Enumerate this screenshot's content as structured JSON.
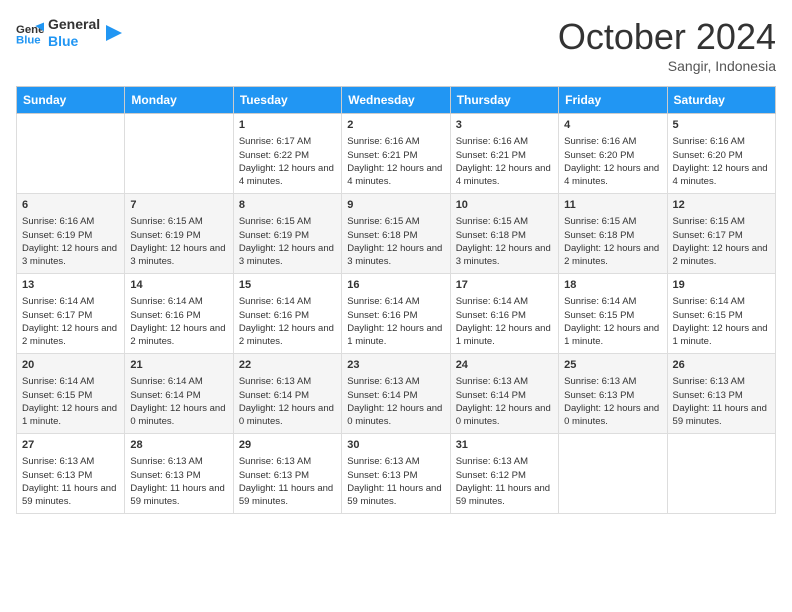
{
  "logo": {
    "text_general": "General",
    "text_blue": "Blue"
  },
  "header": {
    "month": "October 2024",
    "location": "Sangir, Indonesia"
  },
  "weekdays": [
    "Sunday",
    "Monday",
    "Tuesday",
    "Wednesday",
    "Thursday",
    "Friday",
    "Saturday"
  ],
  "weeks": [
    [
      null,
      null,
      {
        "day": 1,
        "sunrise": "6:17 AM",
        "sunset": "6:22 PM",
        "daylight": "12 hours and 4 minutes."
      },
      {
        "day": 2,
        "sunrise": "6:16 AM",
        "sunset": "6:21 PM",
        "daylight": "12 hours and 4 minutes."
      },
      {
        "day": 3,
        "sunrise": "6:16 AM",
        "sunset": "6:21 PM",
        "daylight": "12 hours and 4 minutes."
      },
      {
        "day": 4,
        "sunrise": "6:16 AM",
        "sunset": "6:20 PM",
        "daylight": "12 hours and 4 minutes."
      },
      {
        "day": 5,
        "sunrise": "6:16 AM",
        "sunset": "6:20 PM",
        "daylight": "12 hours and 4 minutes."
      }
    ],
    [
      {
        "day": 6,
        "sunrise": "6:16 AM",
        "sunset": "6:19 PM",
        "daylight": "12 hours and 3 minutes."
      },
      {
        "day": 7,
        "sunrise": "6:15 AM",
        "sunset": "6:19 PM",
        "daylight": "12 hours and 3 minutes."
      },
      {
        "day": 8,
        "sunrise": "6:15 AM",
        "sunset": "6:19 PM",
        "daylight": "12 hours and 3 minutes."
      },
      {
        "day": 9,
        "sunrise": "6:15 AM",
        "sunset": "6:18 PM",
        "daylight": "12 hours and 3 minutes."
      },
      {
        "day": 10,
        "sunrise": "6:15 AM",
        "sunset": "6:18 PM",
        "daylight": "12 hours and 3 minutes."
      },
      {
        "day": 11,
        "sunrise": "6:15 AM",
        "sunset": "6:18 PM",
        "daylight": "12 hours and 2 minutes."
      },
      {
        "day": 12,
        "sunrise": "6:15 AM",
        "sunset": "6:17 PM",
        "daylight": "12 hours and 2 minutes."
      }
    ],
    [
      {
        "day": 13,
        "sunrise": "6:14 AM",
        "sunset": "6:17 PM",
        "daylight": "12 hours and 2 minutes."
      },
      {
        "day": 14,
        "sunrise": "6:14 AM",
        "sunset": "6:16 PM",
        "daylight": "12 hours and 2 minutes."
      },
      {
        "day": 15,
        "sunrise": "6:14 AM",
        "sunset": "6:16 PM",
        "daylight": "12 hours and 2 minutes."
      },
      {
        "day": 16,
        "sunrise": "6:14 AM",
        "sunset": "6:16 PM",
        "daylight": "12 hours and 1 minute."
      },
      {
        "day": 17,
        "sunrise": "6:14 AM",
        "sunset": "6:16 PM",
        "daylight": "12 hours and 1 minute."
      },
      {
        "day": 18,
        "sunrise": "6:14 AM",
        "sunset": "6:15 PM",
        "daylight": "12 hours and 1 minute."
      },
      {
        "day": 19,
        "sunrise": "6:14 AM",
        "sunset": "6:15 PM",
        "daylight": "12 hours and 1 minute."
      }
    ],
    [
      {
        "day": 20,
        "sunrise": "6:14 AM",
        "sunset": "6:15 PM",
        "daylight": "12 hours and 1 minute."
      },
      {
        "day": 21,
        "sunrise": "6:14 AM",
        "sunset": "6:14 PM",
        "daylight": "12 hours and 0 minutes."
      },
      {
        "day": 22,
        "sunrise": "6:13 AM",
        "sunset": "6:14 PM",
        "daylight": "12 hours and 0 minutes."
      },
      {
        "day": 23,
        "sunrise": "6:13 AM",
        "sunset": "6:14 PM",
        "daylight": "12 hours and 0 minutes."
      },
      {
        "day": 24,
        "sunrise": "6:13 AM",
        "sunset": "6:14 PM",
        "daylight": "12 hours and 0 minutes."
      },
      {
        "day": 25,
        "sunrise": "6:13 AM",
        "sunset": "6:13 PM",
        "daylight": "12 hours and 0 minutes."
      },
      {
        "day": 26,
        "sunrise": "6:13 AM",
        "sunset": "6:13 PM",
        "daylight": "11 hours and 59 minutes."
      }
    ],
    [
      {
        "day": 27,
        "sunrise": "6:13 AM",
        "sunset": "6:13 PM",
        "daylight": "11 hours and 59 minutes."
      },
      {
        "day": 28,
        "sunrise": "6:13 AM",
        "sunset": "6:13 PM",
        "daylight": "11 hours and 59 minutes."
      },
      {
        "day": 29,
        "sunrise": "6:13 AM",
        "sunset": "6:13 PM",
        "daylight": "11 hours and 59 minutes."
      },
      {
        "day": 30,
        "sunrise": "6:13 AM",
        "sunset": "6:13 PM",
        "daylight": "11 hours and 59 minutes."
      },
      {
        "day": 31,
        "sunrise": "6:13 AM",
        "sunset": "6:12 PM",
        "daylight": "11 hours and 59 minutes."
      },
      null,
      null
    ]
  ],
  "labels": {
    "sunrise": "Sunrise:",
    "sunset": "Sunset:",
    "daylight": "Daylight:"
  }
}
